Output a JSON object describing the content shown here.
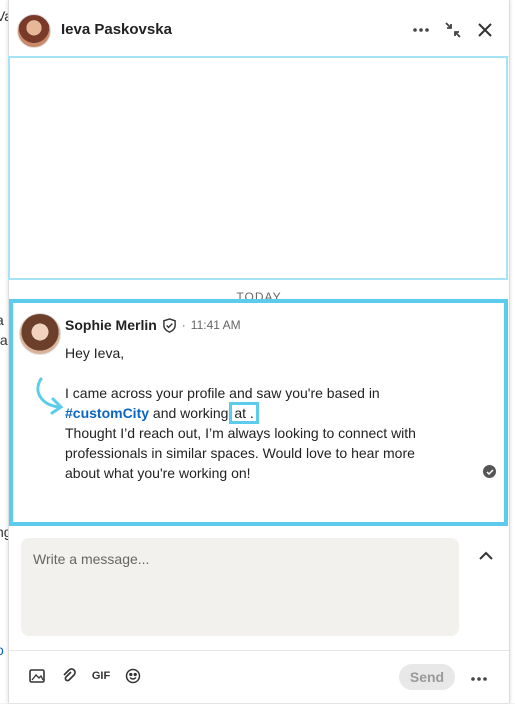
{
  "window": {
    "title": "Ieva Paskovska"
  },
  "background": {
    "left_fragments": [
      "Va",
      "a",
      ":a",
      "ng",
      "o"
    ]
  },
  "divider": {
    "today_label": "TODAY"
  },
  "message": {
    "sender": "Sophie Merlin",
    "separator": "·",
    "time": "11:41 AM",
    "greeting": "Hey Ieva,",
    "line1_a": "I came across your profile and saw you're based in",
    "hashtag": "#customCity",
    "line2_mid": " and working ",
    "placeholder_token": "at .",
    "line3": "Thought I’d reach out, I’m always looking to connect with professionals in similar spaces. Would love to hear more about what you're working on!"
  },
  "composer": {
    "placeholder": "Write a message..."
  },
  "footer": {
    "gif_label": "GIF",
    "send_label": "Send"
  },
  "colors": {
    "highlight": "#5ccbec",
    "link": "#0a66c2"
  }
}
